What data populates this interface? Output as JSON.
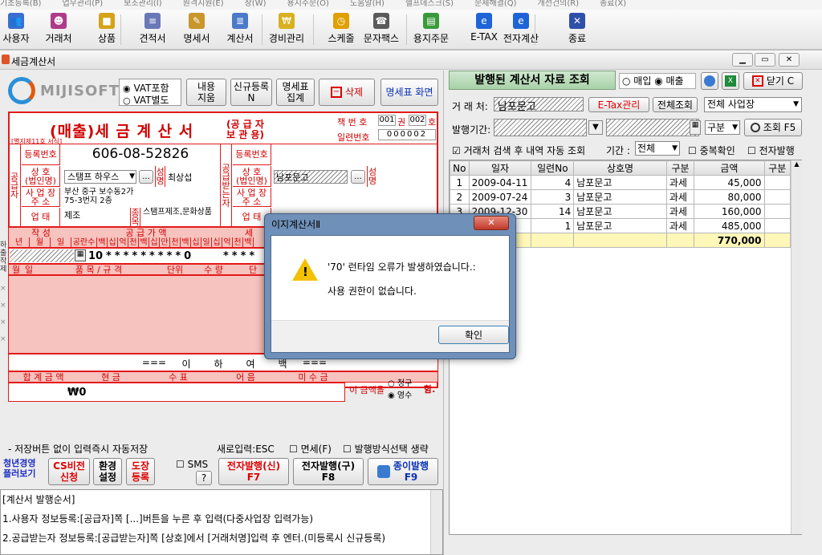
{
  "menubar": {
    "items": [
      "기초등록(B)",
      "업무관리(P)",
      "보조관리(I)",
      "원격지원(E)",
      "창(W)",
      "용지주문(O)",
      "도움말(H)",
      "헬프데스크(S)",
      "문제해결(Q)",
      "개선건의(R)",
      "종료(X)"
    ]
  },
  "toolbar": {
    "items": [
      {
        "name": "user",
        "label": "사용자",
        "icon": "users-icon",
        "color": "#3a6fd0"
      },
      {
        "name": "client",
        "label": "거래처",
        "icon": "people-icon",
        "color": "#b03a8a"
      },
      {
        "name": "product",
        "label": "상품",
        "icon": "box-icon",
        "color": "#d6a318"
      },
      {
        "name": "quote",
        "label": "견적서",
        "icon": "document-icon",
        "color": "#6a78b8"
      },
      {
        "name": "statement",
        "label": "명세서",
        "icon": "edit-document-icon",
        "color": "#c8962a"
      },
      {
        "name": "invoice",
        "label": "계산서",
        "icon": "invoice-icon",
        "color": "#4a7ac8"
      },
      {
        "name": "expense",
        "label": "경비관리",
        "icon": "coin-icon",
        "color": "#d8b020"
      },
      {
        "name": "schedule",
        "label": "스케줄",
        "icon": "clock-icon",
        "color": "#e0a000"
      },
      {
        "name": "sms",
        "label": "문자팩스",
        "icon": "fax-icon",
        "color": "#5a5a5a"
      },
      {
        "name": "order",
        "label": "용지주문",
        "icon": "cart-icon",
        "color": "#3a9a3a"
      },
      {
        "name": "etax",
        "label": "E-TAX",
        "icon": "ie-icon",
        "color": "#1e64d8"
      },
      {
        "name": "etaxcalc",
        "label": "전자계산",
        "icon": "ie-icon",
        "color": "#1e64d8"
      },
      {
        "name": "exit",
        "label": "종료",
        "icon": "close-icon",
        "color": "#2f4fa8"
      }
    ]
  },
  "window": {
    "title": "세금계산서"
  },
  "left": {
    "logo": "MIJISOFT",
    "vat_include": "VAT포함",
    "vat_separate": "VAT별도",
    "btn_clear": "내용\n지움",
    "btn_new": "신규등록\nN",
    "btn_statement": "명세표\n집계",
    "btn_delete": "삭제",
    "btn_statement_screen": "명세표 화면",
    "form_title": "(매출)세 금 계 산 서",
    "form_sub": "(공 급 자\n보 관 용)",
    "form_note": "[별지제11호 서식]",
    "book_label": "책 번 호",
    "book_val1": "001",
    "book_k1": "권",
    "book_val2": "002",
    "book_k2": "호",
    "serial_label": "일련번호",
    "serial_val": "000002",
    "supplier_v": "공\n급\n자",
    "receiver_v": "공\n급\n받\n는\n자",
    "reg_label": "등록번호",
    "reg_value": "606-08-52826",
    "name_label": "상 호\n(법인명)",
    "name_value": "스탬프 하우스",
    "rep_label": "성\n명",
    "rep_value": "최상섭",
    "addr_label": "사 업 장\n주 소",
    "addr_value": "부산 중구 보수동2가\n75-3번지 2층",
    "biz_label": "업 태",
    "biz_value": "제조",
    "item_label": "종\n목",
    "item_value": "스탬프제조,문화상품",
    "r_reg_label": "등록번호",
    "r_name_label": "상 호\n(법인명)",
    "r_name_value": "남포문고",
    "r_rep_label": "성\n명",
    "r_addr_label": "사 업 장\n주 소",
    "r_biz_label": "업 태",
    "write_label": "작 성",
    "supply_label": "공 급 가 액",
    "tax_label": "세",
    "ymd": [
      "년",
      "월",
      "일"
    ],
    "digit_heads": [
      "공란수",
      "백",
      "십",
      "억",
      "천",
      "백",
      "십",
      "만",
      "천",
      "백",
      "십",
      "일"
    ],
    "tax_heads": [
      "십",
      "억",
      "천",
      "백"
    ],
    "blank_count": "10",
    "supply_digits": "*********0",
    "tax_digits": "****",
    "row_heads": [
      "월",
      "일",
      "품 목 / 규 격",
      "단위",
      "수 량",
      "단"
    ],
    "footer_chars": [
      "===",
      "이",
      "하",
      "여",
      "백",
      "==="
    ],
    "total_heads": [
      "합 계 금 액",
      "현 금",
      "수 표",
      "어 음",
      "미 수 금"
    ],
    "total_value": "₩0",
    "amount_label": "이 금액을",
    "claim": "청구",
    "receipt": "영수",
    "ham": "함.",
    "autosave_note": "- 저장버튼 없이 입력즉시 자동저장",
    "new_input": "새로입력:ESC",
    "tax_free": "면세(F)",
    "issue_omit": "발행방식선택 생략",
    "btn_youth": "청년경영\n플러보기",
    "btn_cs": "CS비전\n신청",
    "btn_env": "환경\n설정",
    "btn_stamp": "도장\n등록",
    "sms": "SMS",
    "sms_q": "?",
    "btn_e_new": "전자발행(신)\nF7",
    "btn_e_old": "전자발행(구)\nF8",
    "btn_paper": "종이발행\nF9",
    "guide_title": "[계산서 발행순서]",
    "guide_1": "1.사용자 정보등록:[공급자]쪽 [...]버튼을 누른 후 입력(다중사업장 입력가능)",
    "guide_2": "2.공급받는자 정보등록:[공급받는자]쪽 [상호]에서 [거래처명]입력 후 엔터.(미등록시 신규등록)"
  },
  "right": {
    "title": "발행된 계산서 자료 조회",
    "purchase": "매입",
    "sales": "매출",
    "btn_close": "닫기 C",
    "client_label": "거 래 처:",
    "client_value": "남포문고",
    "btn_etax": "E-Tax관리",
    "btn_all": "전체조회",
    "site_value": "전체 사업장",
    "period_label": "발행기간:",
    "div_value": "구분",
    "btn_search": "조회 F5",
    "auto_search": "거래처 검색 후 내역 자동 조회",
    "period2": "기간 :",
    "period2_value": "전체",
    "dup": "중복확인",
    "e_issue": "전자발행",
    "columns": [
      "No",
      "일자",
      "일련No",
      "상호명",
      "구분",
      "금액",
      "구분"
    ],
    "rows": [
      {
        "no": "1",
        "date": "2009-04-11",
        "serial": "4",
        "name": "남포문고",
        "type": "과세",
        "amount": "45,000"
      },
      {
        "no": "2",
        "date": "2009-07-24",
        "serial": "3",
        "name": "남포문고",
        "type": "과세",
        "amount": "80,000"
      },
      {
        "no": "3",
        "date": "2009-12-30",
        "serial": "14",
        "name": "남포문고",
        "type": "과세",
        "amount": "160,000"
      },
      {
        "no": "4",
        "date": "2009-07",
        "serial": "1",
        "name": "남포문고",
        "type": "과세",
        "amount": "485,000"
      }
    ],
    "total": "770,000"
  },
  "dialog": {
    "title": "이지계산서Ⅱ",
    "message1": "'70' 런타임 오류가 발생하였습니다.:",
    "message2": "사용 권한이 없습니다.",
    "ok": "확인",
    "icon": "warning-icon"
  }
}
